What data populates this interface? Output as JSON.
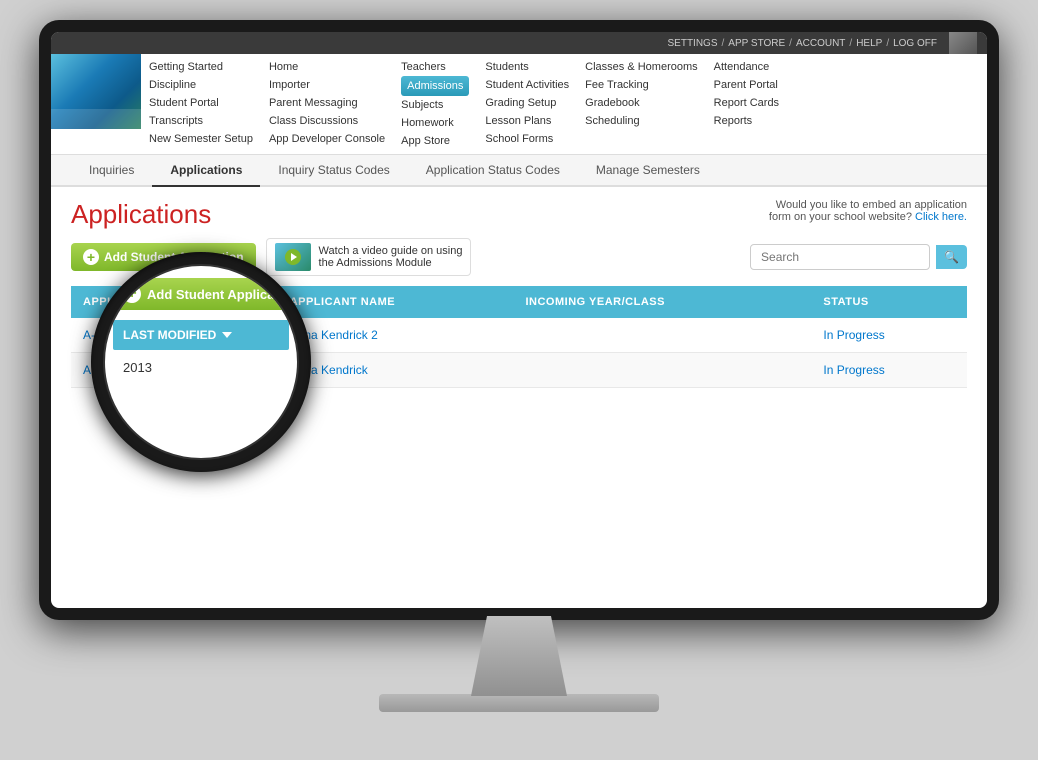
{
  "topbar": {
    "links": [
      "SETTINGS",
      "APP STORE",
      "ACCOUNT",
      "HELP",
      "LOG OFF"
    ],
    "separators": [
      "/",
      "/",
      "/",
      "/"
    ]
  },
  "nav": {
    "columns": [
      {
        "items": [
          "Getting Started",
          "Discipline",
          "Student Portal",
          "Transcripts",
          "New Semester Setup"
        ]
      },
      {
        "items": [
          "Home",
          "Importer",
          "Parent Messaging",
          "Class Discussions",
          "App Developer Console"
        ]
      },
      {
        "items": [
          "Teachers",
          "Admissions",
          "Subjects",
          "Homework",
          "App Store"
        ]
      },
      {
        "items": [
          "Students",
          "Student Activities",
          "Grading Setup",
          "Lesson Plans",
          "School Forms"
        ]
      },
      {
        "items": [
          "Classes & Homerooms",
          "Fee Tracking",
          "Gradebook",
          "Scheduling"
        ]
      },
      {
        "items": [
          "Attendance",
          "Parent Portal",
          "Report Cards",
          "Reports"
        ]
      }
    ]
  },
  "tabs": {
    "items": [
      "Inquiries",
      "Applications",
      "Inquiry Status Codes",
      "Application Status Codes",
      "Manage Semesters"
    ],
    "active": "Applications"
  },
  "page": {
    "title": "Applications",
    "embed_text": "Would you like to embed an application\nform on your school website?",
    "embed_link": "Click here.",
    "add_button": "Add Student Application",
    "video_guide_text": "Watch a video guide on using\nthe Admissions Module",
    "search_placeholder": "Search"
  },
  "table": {
    "columns": [
      "APPLICATION #",
      "APPLICANT NAME",
      "INCOMING YEAR/CLASS",
      "STATUS"
    ],
    "sort_column": "LAST MODIFIED",
    "rows": [
      {
        "app_num": "A-000004",
        "applicant_name": "Anna Kendrick 2",
        "incoming_year": "",
        "status": "In Progress"
      },
      {
        "app_num": "A-000003",
        "applicant_name": "Anna Kendrick",
        "incoming_year": "",
        "status": "In Progress"
      }
    ]
  },
  "magnifier": {
    "add_label": "Add Student Application",
    "sort_label": "LAST MODIFIED",
    "date_text": "2013"
  }
}
